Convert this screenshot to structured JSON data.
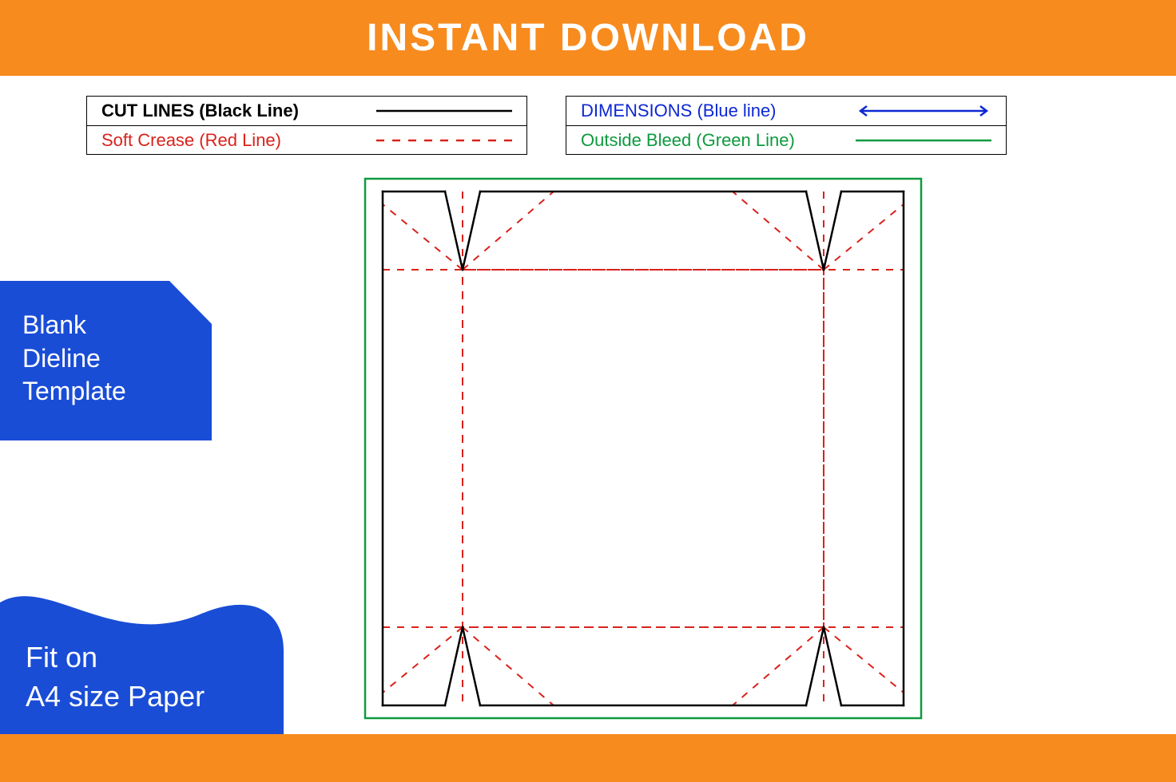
{
  "colors": {
    "orange": "#f78b1e",
    "blue": "#1a4dd6",
    "red": "#d9221c",
    "green": "#0e9a3f",
    "black": "#000000",
    "dim_blue": "#0d27d4"
  },
  "top_banner": {
    "text": "INSTANT DOWNLOAD"
  },
  "badge_template": {
    "line1": "Blank",
    "line2": "Dieline",
    "line3": "Template"
  },
  "badge_paper": {
    "line1": "Fit on",
    "line2": "A4 size Paper"
  },
  "legend": {
    "cut": {
      "label": "CUT LINES (Black Line)"
    },
    "crease": {
      "label": "Soft Crease (Red Line)"
    },
    "dim": {
      "label": "DIMENSIONS (Blue line)"
    },
    "bleed": {
      "label": "Outside Bleed (Green Line)"
    }
  }
}
